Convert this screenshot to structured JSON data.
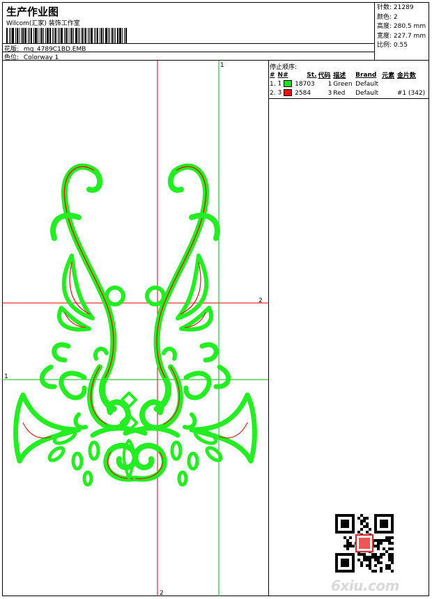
{
  "header": {
    "title": "生产作业图",
    "subtitle": "Wilcom(汇家) 装饰工作室",
    "design_label": "花版:",
    "design_value": "mg_4789C1BD.EMB",
    "colorway_label": "色位:",
    "colorway_value": "Colorway 1"
  },
  "stats": [
    {
      "label": "针数:",
      "value": "21289"
    },
    {
      "label": "颜色:",
      "value": "2"
    },
    {
      "label": "高度:",
      "value": "280.5 mm"
    },
    {
      "label": "宽度:",
      "value": "227.7 mm"
    },
    {
      "label": "比例:",
      "value": "0.55"
    }
  ],
  "stop_sequence": {
    "title": "停止顺序:",
    "columns": [
      "#",
      "N#",
      "St.",
      "代码",
      "描述",
      "Brand",
      "元素",
      "金片数"
    ],
    "rows": [
      {
        "num": "1.",
        "n": "1",
        "color": "#22dd22",
        "stitches": "18703",
        "code": "1",
        "desc": "Green",
        "brand": "Default",
        "element": "",
        "sequins": ""
      },
      {
        "num": "2.",
        "n": "3",
        "color": "#ee1111",
        "stitches": "2584",
        "code": "3",
        "desc": "Red",
        "brand": "Default",
        "element": "",
        "sequins": "#1 (342)"
      }
    ]
  },
  "guides": {
    "labels": {
      "top_v": "1",
      "right_h": "2",
      "left_h": "1",
      "bottom_v": "2"
    },
    "colors": {
      "red": "#e00000",
      "green": "#00c000"
    }
  },
  "design_colors": {
    "green": "#22ee22",
    "red": "#ee1111"
  },
  "watermark": "6xiu.com",
  "icons": {
    "qr": "qr-code-icon",
    "stamp": "seal-icon"
  }
}
